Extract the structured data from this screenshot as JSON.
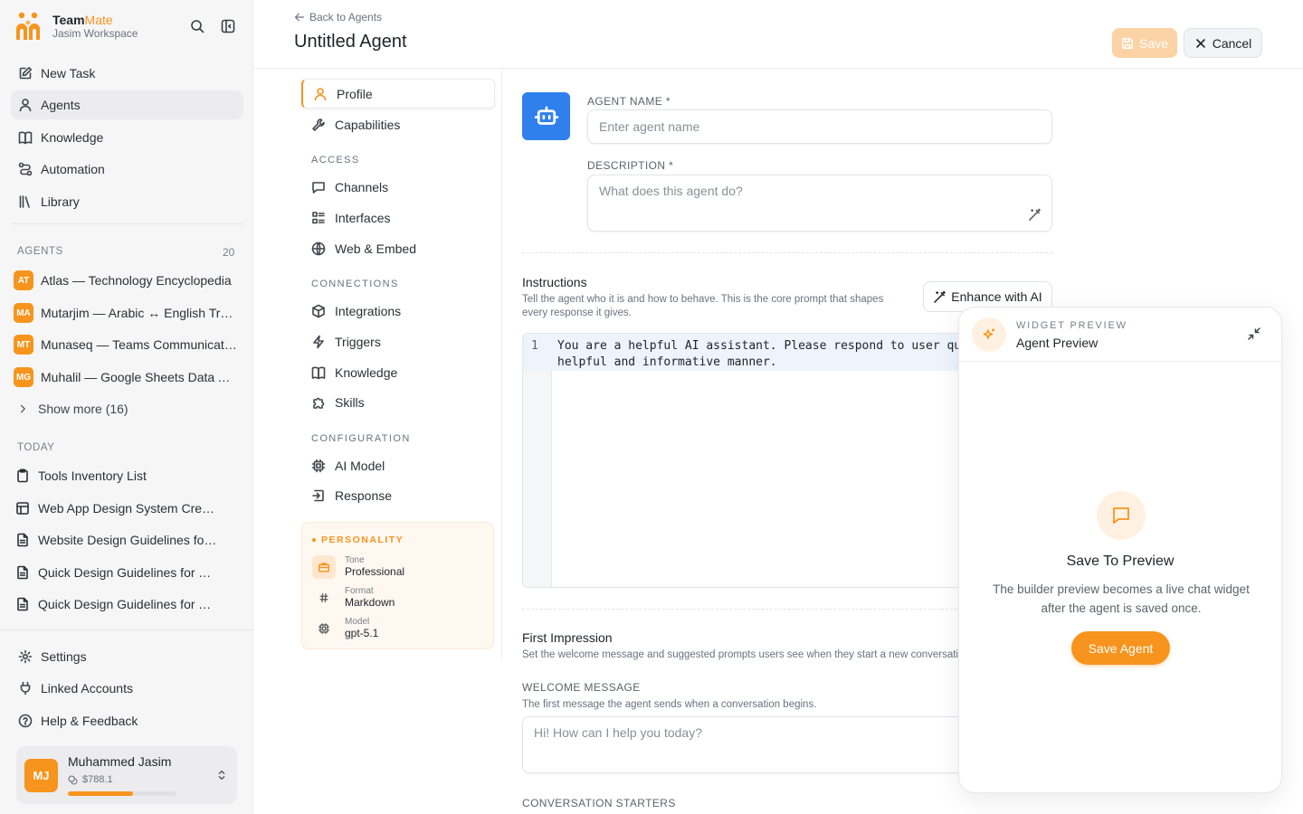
{
  "brand": {
    "name_a": "Team",
    "name_b": "Mate",
    "workspace": "Jasim Workspace"
  },
  "sidebar": {
    "nav": [
      {
        "label": "New Task",
        "icon": "edit-icon"
      },
      {
        "label": "Agents",
        "icon": "user-icon",
        "active": true
      },
      {
        "label": "Knowledge",
        "icon": "book-icon"
      },
      {
        "label": "Automation",
        "icon": "route-icon"
      },
      {
        "label": "Library",
        "icon": "library-icon"
      }
    ],
    "agents_label": "AGENTS",
    "agents_count": "20",
    "agents": [
      {
        "initials": "AT",
        "name": "Atlas — Technology Encyclopedia"
      },
      {
        "initials": "MA",
        "name": "Mutarjim — Arabic ↔ English Translator"
      },
      {
        "initials": "MT",
        "name": "Munaseq — Teams Communication"
      },
      {
        "initials": "MG",
        "name": "Muhalil — Google Sheets Data Analyst"
      }
    ],
    "show_more": "Show more (16)",
    "today_label": "TODAY",
    "tasks": [
      {
        "label": "Tools Inventory List",
        "icon": "clipboard-icon"
      },
      {
        "label": "Web App Design System Creation",
        "icon": "layout-icon"
      },
      {
        "label": "Website Design Guidelines for ...",
        "icon": "file-icon"
      },
      {
        "label": "Quick Design Guidelines for Ta...",
        "icon": "file-icon"
      },
      {
        "label": "Quick Design Guidelines for Ta...",
        "icon": "file-icon"
      }
    ],
    "bottom_nav": [
      {
        "label": "Settings",
        "icon": "gear-icon"
      },
      {
        "label": "Linked Accounts",
        "icon": "plug-icon"
      },
      {
        "label": "Help & Feedback",
        "icon": "help-icon"
      }
    ],
    "user": {
      "initials": "MJ",
      "name": "Muhammed Jasim",
      "credit": "$788.1",
      "credit_fraction": 0.6
    }
  },
  "header": {
    "back_label": "Back to Agents",
    "title": "Untitled Agent",
    "save_label": "Save",
    "cancel_label": "Cancel"
  },
  "builder_nav": {
    "items": [
      {
        "label": "Profile",
        "icon": "user-icon",
        "active": true
      },
      {
        "label": "Capabilities",
        "icon": "wrench-icon"
      }
    ],
    "access_label": "ACCESS",
    "access": [
      {
        "label": "Channels",
        "icon": "message-icon"
      },
      {
        "label": "Interfaces",
        "icon": "list-icon"
      },
      {
        "label": "Web & Embed",
        "icon": "globe-icon"
      }
    ],
    "connections_label": "CONNECTIONS",
    "connections": [
      {
        "label": "Integrations",
        "icon": "box-icon"
      },
      {
        "label": "Triggers",
        "icon": "zap-icon"
      },
      {
        "label": "Knowledge",
        "icon": "book-icon"
      },
      {
        "label": "Skills",
        "icon": "puzzle-icon"
      }
    ],
    "configuration_label": "CONFIGURATION",
    "configuration": [
      {
        "label": "AI Model",
        "icon": "cpu-icon"
      },
      {
        "label": "Response",
        "icon": "reply-icon"
      }
    ],
    "personality": {
      "title": "PERSONALITY",
      "rows": [
        {
          "key": "Tone",
          "value": "Professional",
          "icon": "briefcase-icon"
        },
        {
          "key": "Format",
          "value": "Markdown",
          "icon": "hash-icon"
        },
        {
          "key": "Model",
          "value": "gpt-5.1",
          "icon": "cpu-icon"
        }
      ]
    }
  },
  "form": {
    "name_label": "AGENT NAME *",
    "name_placeholder": "Enter agent name",
    "description_label": "DESCRIPTION *",
    "description_placeholder": "What does this agent do?",
    "instructions_title": "Instructions",
    "instructions_desc": "Tell the agent who it is and how to behave. This is the core prompt that shapes every response it gives.",
    "enhance_label": "Enhance with AI",
    "line_number": "1",
    "instructions_text": "You are a helpful AI assistant. Please respond to user queries in a\nhelpful and informative manner.",
    "first_impression_title": "First Impression",
    "first_impression_desc": "Set the welcome message and suggested prompts users see when they start a new conversation.",
    "welcome_label": "WELCOME MESSAGE",
    "welcome_desc": "The first message the agent sends when a conversation begins.",
    "welcome_placeholder": "Hi! How can I help you today?",
    "starters_label": "CONVERSATION STARTERS"
  },
  "widget": {
    "kicker": "WIDGET PREVIEW",
    "title": "Agent Preview",
    "heading": "Save To Preview",
    "description": "The builder preview becomes a live chat widget after the agent is saved once.",
    "button": "Save Agent"
  },
  "colors": {
    "accent": "#f7941d",
    "agent_avatar": "#2f80ed"
  }
}
